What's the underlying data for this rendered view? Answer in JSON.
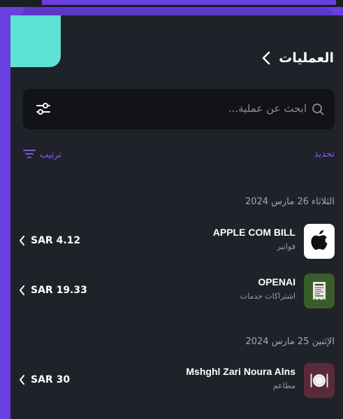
{
  "header": {
    "title": "العمليات",
    "back_icon": "chevron-left-icon"
  },
  "search": {
    "placeholder": "ابحث عن عملية...",
    "search_icon": "search-icon",
    "filter_icon": "filter-sliders-icon"
  },
  "toolbar": {
    "sort_label": "ترتيب",
    "sort_icon": "sort-lines-icon",
    "select_label": "تحديد"
  },
  "groups": [
    {
      "date": "الثلاثاء 26 مارس 2024",
      "transactions": [
        {
          "merchant": "APPLE COM BILL",
          "category": "فواتير",
          "amount": "SAR 4.12",
          "icon": "apple-logo-icon",
          "icon_bg": "#ffffff"
        },
        {
          "merchant": "OPENAI",
          "category": "اشتراكات خدمات",
          "amount": "SAR 19.33",
          "icon": "receipt-icon",
          "icon_bg": "#3b5d2c"
        }
      ]
    },
    {
      "date": "الإثنين 25 مارس 2024",
      "transactions": [
        {
          "merchant": "Mshghl Zari Noura Alns",
          "category": "مطاعم",
          "amount": "SAR 30",
          "icon": "restaurant-plate-icon",
          "icon_bg": "#5a2a3a"
        }
      ]
    }
  ],
  "colors": {
    "accent": "#8b5cf6",
    "panel": "#1f2228",
    "search_bg": "#111318",
    "teal": "#5ee2d6",
    "purple": "#6a3fe0"
  }
}
